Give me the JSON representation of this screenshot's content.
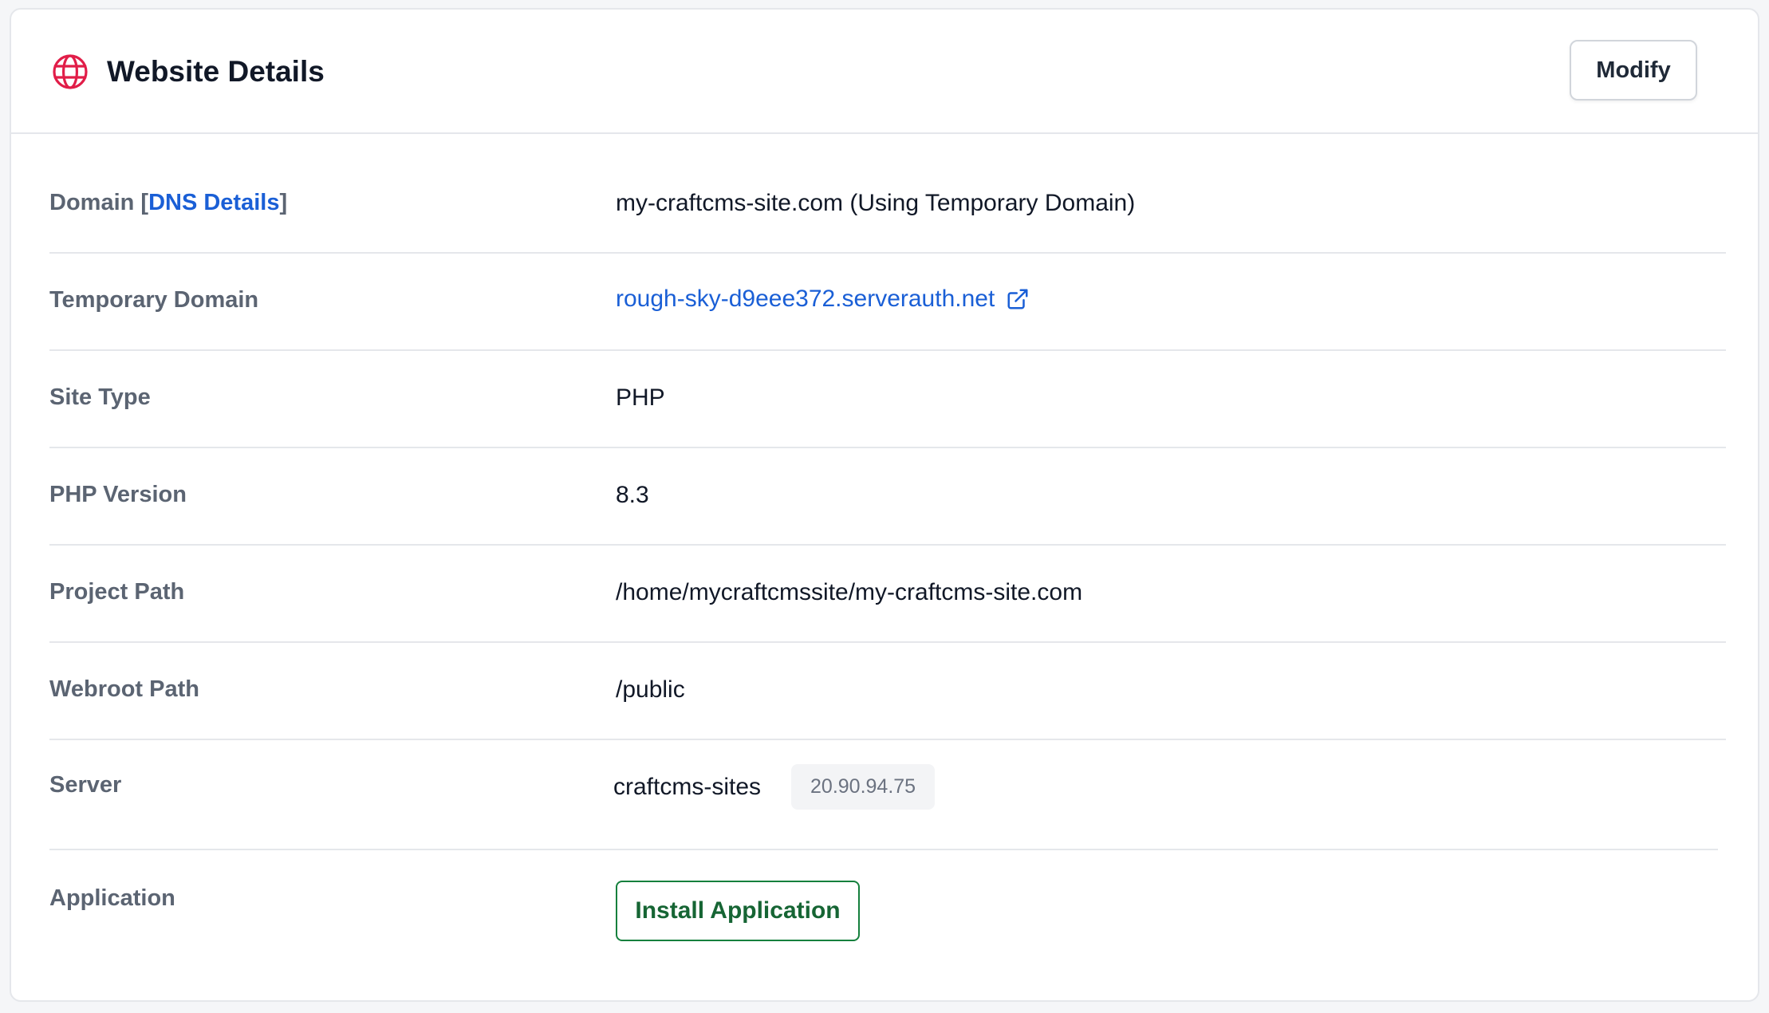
{
  "header": {
    "title": "Website Details",
    "modify_label": "Modify",
    "icon": "globe-icon",
    "icon_color": "#e11d48"
  },
  "rows": {
    "domain": {
      "label": "Domain",
      "label_link": "DNS Details",
      "value": "my-craftcms-site.com (Using Temporary Domain)"
    },
    "temporary_domain": {
      "label": "Temporary Domain",
      "value": "rough-sky-d9eee372.serverauth.net",
      "icon": "external-link-icon"
    },
    "site_type": {
      "label": "Site Type",
      "value": "PHP"
    },
    "php_version": {
      "label": "PHP Version",
      "value": "8.3"
    },
    "project_path": {
      "label": "Project Path",
      "value": "/home/mycraftcmssite/my-craftcms-site.com"
    },
    "webroot_path": {
      "label": "Webroot Path",
      "value": "/public"
    },
    "server": {
      "label": "Server",
      "value": "craftcms-sites",
      "ip": "20.90.94.75"
    },
    "application": {
      "label": "Application",
      "button_label": "Install Application"
    }
  },
  "colors": {
    "link": "#1a5fd6",
    "install_green": "#15803d",
    "label_gray": "#5b6472",
    "border": "#e5e7eb"
  }
}
